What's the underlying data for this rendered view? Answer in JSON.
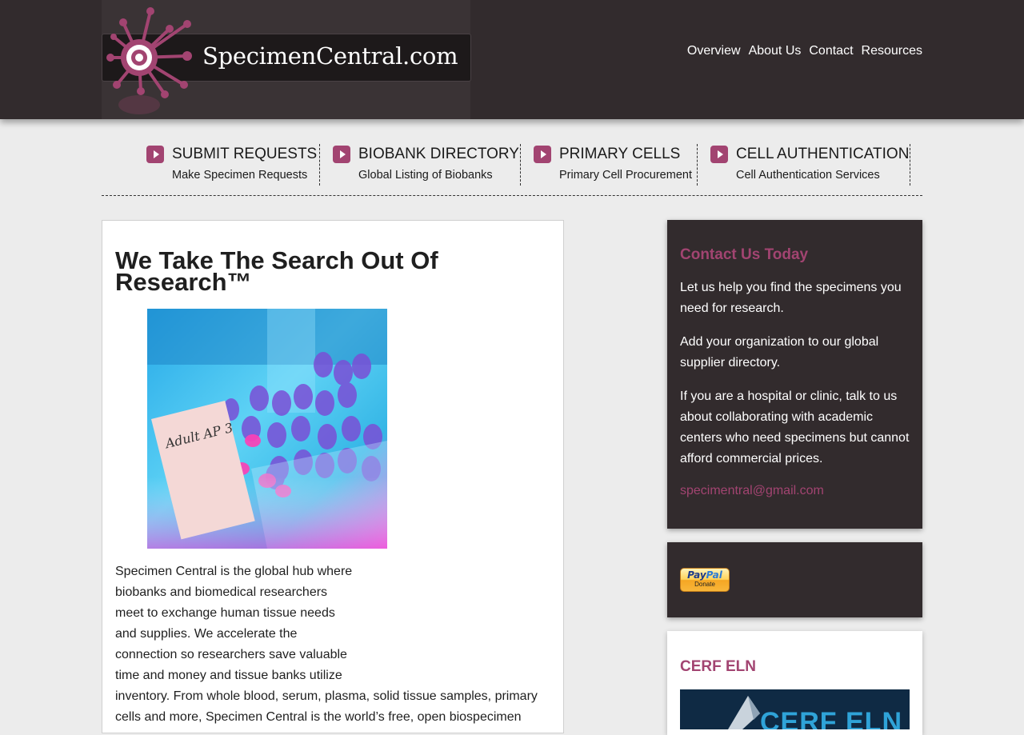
{
  "site": {
    "logo_text": "SpecimenCentral.com",
    "brand_color": "#a24471",
    "header_bg": "#322b2d"
  },
  "top_nav": [
    "Overview",
    "About Us",
    "Contact",
    "Resources"
  ],
  "features": [
    {
      "title": "SUBMIT REQUESTS",
      "subtitle": "Make Specimen Requests",
      "icon": "play-arrow-icon"
    },
    {
      "title": "BIOBANK DIRECTORY",
      "subtitle": "Global Listing of Biobanks",
      "icon": "play-arrow-icon"
    },
    {
      "title": "PRIMARY CELLS",
      "subtitle": "Primary Cell Procurement",
      "icon": "play-arrow-icon"
    },
    {
      "title": "CELL AUTHENTICATION",
      "subtitle": "Cell Authentication Services",
      "icon": "play-arrow-icon"
    }
  ],
  "main": {
    "title": "We Take The Search Out Of Research™",
    "image_label": "Adult AP 3",
    "intro_narrow_lines": [
      "Specimen Central is the global hub where",
      "biobanks and biomedical researchers",
      "meet to exchange human tissue needs",
      "and supplies. We accelerate the",
      "connection so researchers save valuable",
      "time and money and tissue banks utilize"
    ],
    "intro_wide_lines": [
      "inventory. From whole blood, serum, plasma, solid tissue samples, primary",
      "cells and more, Specimen Central is the world’s free, open biospecimen"
    ]
  },
  "sidebar": {
    "contact": {
      "heading": "Contact Us Today",
      "paragraphs": [
        "Let us help you find the specimens you need for research.",
        "Add your organization to our global supplier directory.",
        "If you are a hospital or clinic, talk to us about collaborating with academic centers who need specimens but cannot afford commercial prices."
      ],
      "email": "specimentral@gmail.com"
    },
    "donate": {
      "paypal_brand_a": "Pay",
      "paypal_brand_b": "Pal",
      "button_label": "Donate"
    },
    "cerf": {
      "heading": "CERF ELN",
      "banner_text": "CERF ELN"
    }
  }
}
